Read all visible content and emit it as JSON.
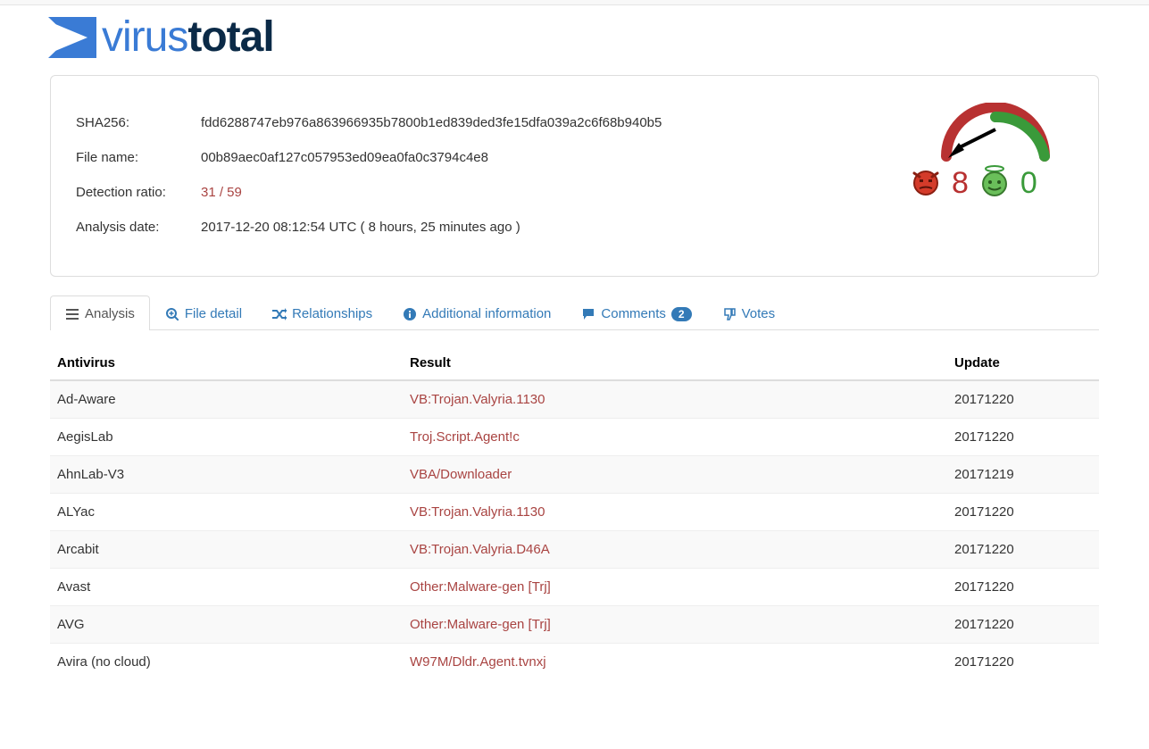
{
  "logo": {
    "word1": "virus",
    "word2": "total"
  },
  "meta": {
    "sha256_label": "SHA256:",
    "sha256_value": "fdd6288747eb976a863966935b7800b1ed839ded3fe15dfa039a2c6f68b940b5",
    "filename_label": "File name:",
    "filename_value": "00b89aec0af127c057953ed09ea0fa0c3794c4e8",
    "ratio_label": "Detection ratio:",
    "ratio_value": "31 / 59",
    "date_label": "Analysis date:",
    "date_value": "2017-12-20 08:12:54 UTC ( 8 hours, 25 minutes ago )"
  },
  "verdict": {
    "malicious_votes": "8",
    "clean_votes": "0"
  },
  "tabs": {
    "analysis": "Analysis",
    "file_detail": "File detail",
    "relationships": "Relationships",
    "additional": "Additional information",
    "comments": "Comments",
    "comments_count": "2",
    "votes": "Votes"
  },
  "table": {
    "headers": {
      "antivirus": "Antivirus",
      "result": "Result",
      "update": "Update"
    },
    "rows": [
      {
        "av": "Ad-Aware",
        "result": "VB:Trojan.Valyria.1130",
        "update": "20171220"
      },
      {
        "av": "AegisLab",
        "result": "Troj.Script.Agent!c",
        "update": "20171220"
      },
      {
        "av": "AhnLab-V3",
        "result": "VBA/Downloader",
        "update": "20171219"
      },
      {
        "av": "ALYac",
        "result": "VB:Trojan.Valyria.1130",
        "update": "20171220"
      },
      {
        "av": "Arcabit",
        "result": "VB:Trojan.Valyria.D46A",
        "update": "20171220"
      },
      {
        "av": "Avast",
        "result": "Other:Malware-gen [Trj]",
        "update": "20171220"
      },
      {
        "av": "AVG",
        "result": "Other:Malware-gen [Trj]",
        "update": "20171220"
      },
      {
        "av": "Avira (no cloud)",
        "result": "W97M/Dldr.Agent.tvnxj",
        "update": "20171220"
      }
    ]
  }
}
